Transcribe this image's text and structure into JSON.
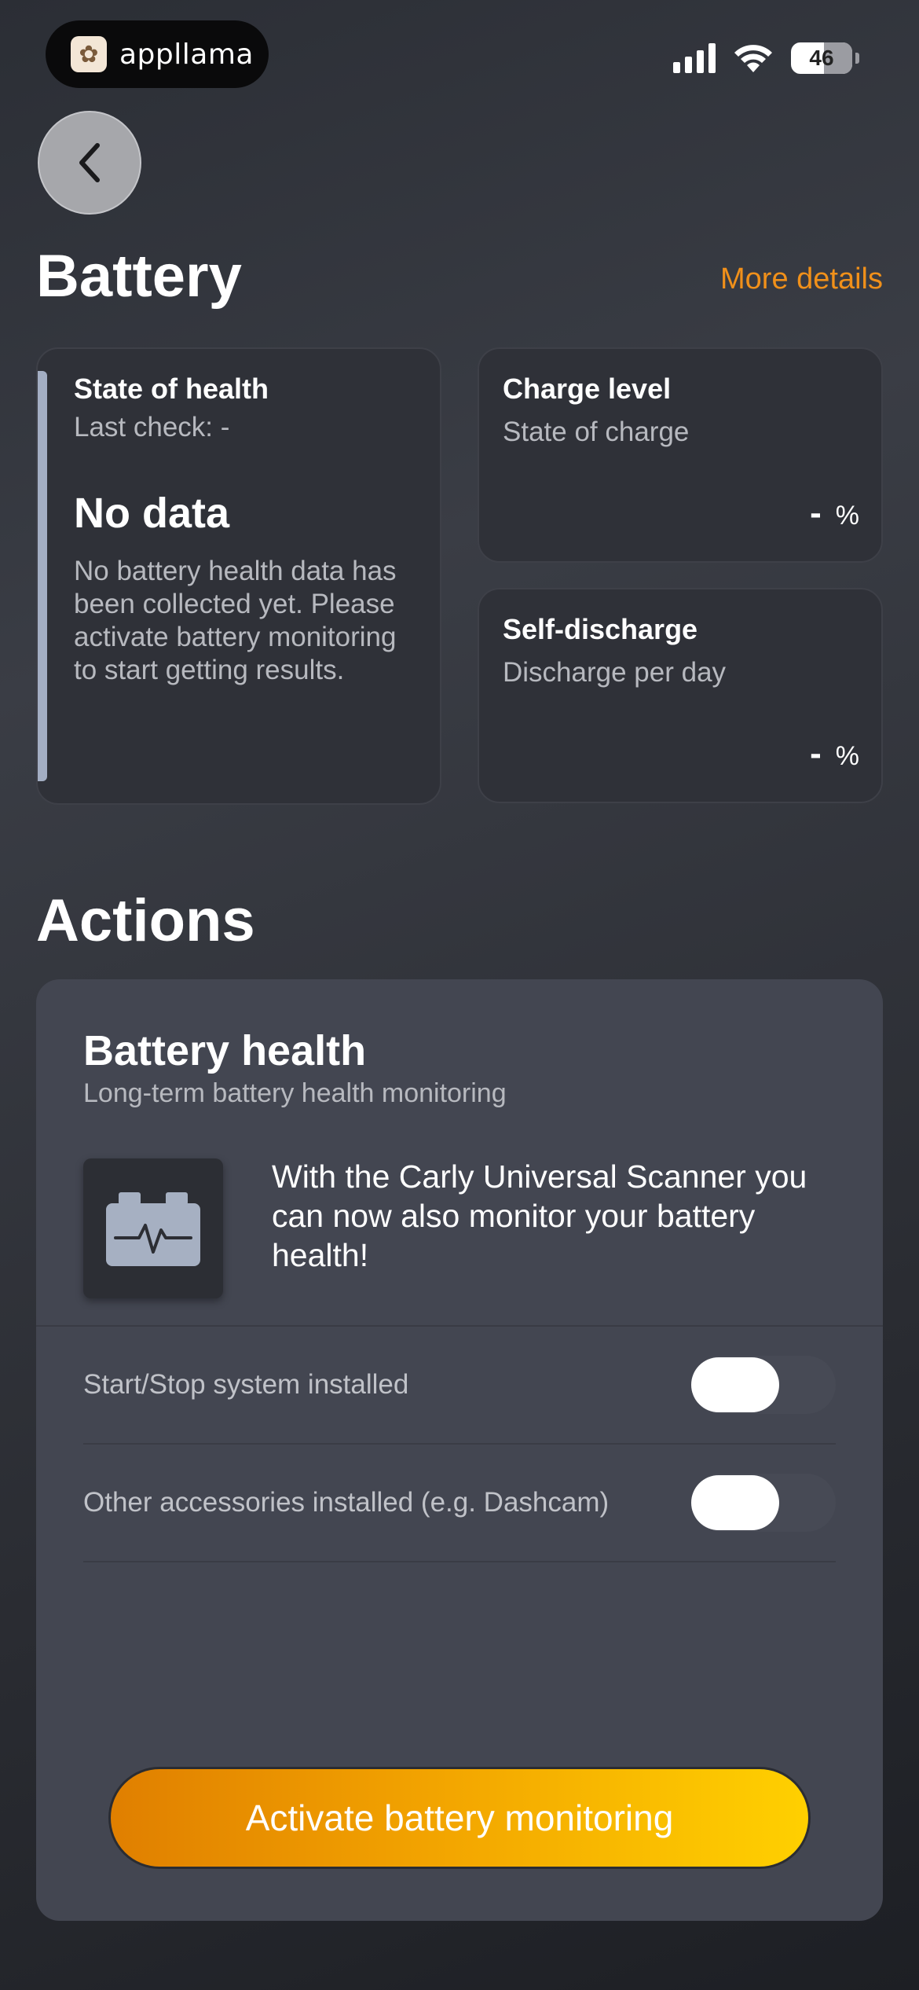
{
  "status_bar": {
    "brand": "appllama",
    "battery_percent": "46",
    "icons": [
      "signal-icon",
      "wifi-icon",
      "battery-icon"
    ]
  },
  "header": {
    "back_icon": "chevron-left-icon",
    "title": "Battery",
    "more_details": "More details"
  },
  "cards": {
    "state_of_health": {
      "title": "State of health",
      "subtitle": "Last check: -",
      "status": "No data",
      "description": "No battery health data has been collected yet. Please activate battery monitoring to start getting results."
    },
    "charge_level": {
      "title": "Charge level",
      "subtitle": "State of charge",
      "value": "-",
      "unit": "%"
    },
    "self_discharge": {
      "title": "Self-discharge",
      "subtitle": "Discharge per day",
      "value": "-",
      "unit": "%"
    }
  },
  "actions": {
    "title": "Actions",
    "battery_health": {
      "title": "Battery health",
      "subtitle": "Long-term battery health monitoring",
      "icon": "battery-pulse-icon",
      "promo": "With the Carly Universal Scanner you can now also monitor your battery health!",
      "toggles": [
        {
          "label": "Start/Stop system installed",
          "on": false
        },
        {
          "label": "Other accessories installed (e.g. Dashcam)",
          "on": false
        }
      ],
      "activate_label": "Activate battery monitoring"
    }
  },
  "colors": {
    "accent": "#f0901a",
    "background": "#2b2e35",
    "card": "#2f3138",
    "panel": "#434651",
    "health_bar": "#a3aec3",
    "button_start": "#e07f00",
    "button_end": "#ffd000"
  }
}
